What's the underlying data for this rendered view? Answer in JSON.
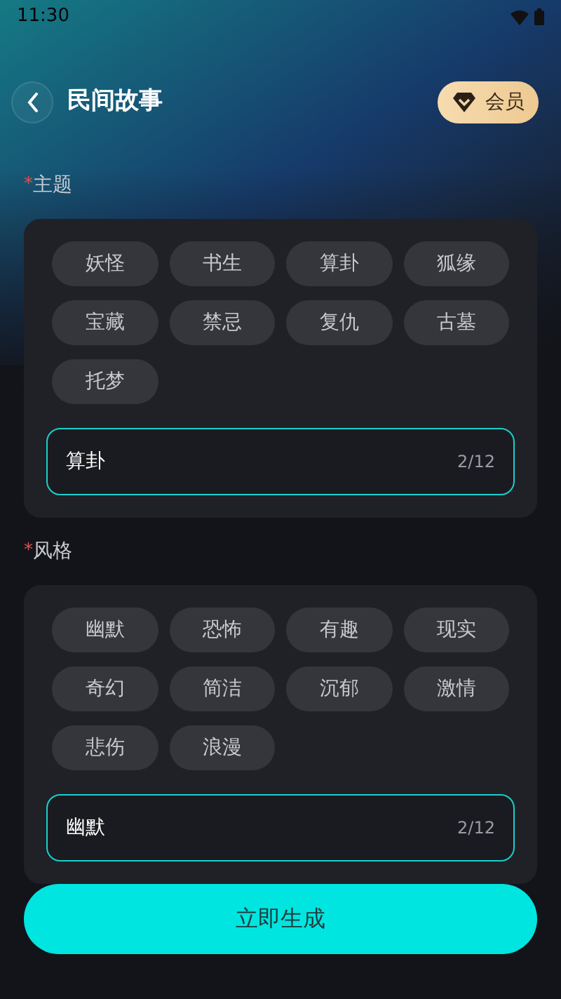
{
  "status_bar": {
    "time": "11:30"
  },
  "header": {
    "title": "民间故事",
    "vip_label": "会员"
  },
  "sections": [
    {
      "label": "主题",
      "required_mark": "*",
      "tags": [
        "妖怪",
        "书生",
        "算卦",
        "狐缘",
        "宝藏",
        "禁忌",
        "复仇",
        "古墓",
        "托梦"
      ],
      "input": {
        "value": "算卦",
        "count": "2/12"
      }
    },
    {
      "label": "风格",
      "required_mark": "*",
      "tags": [
        "幽默",
        "恐怖",
        "有趣",
        "现实",
        "奇幻",
        "简洁",
        "沉郁",
        "激情",
        "悲伤",
        "浪漫"
      ],
      "input": {
        "value": "幽默",
        "count": "2/12"
      }
    }
  ],
  "generate_button": "立即生成"
}
